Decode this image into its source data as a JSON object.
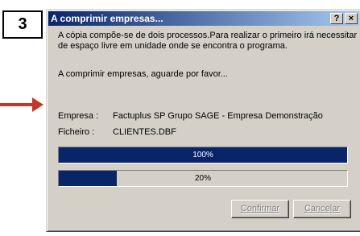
{
  "step": {
    "number": "3"
  },
  "window": {
    "title": "A comprimir empresas...",
    "help_label": "?",
    "close_label": "×"
  },
  "body": {
    "description": "A cópia compõe-se de dois processos.Para realizar o primeiro irá necessitar de espaço livre em unidade onde se encontra o programa.",
    "status": "A comprimir empresas, aguarde por favor...",
    "empresa_label": "Empresa :",
    "empresa_value": "Factuplus SP Grupo SAGE - Empresa Demonstração",
    "ficheiro_label": "Ficheiro :",
    "ficheiro_value": "CLIENTES.DBF"
  },
  "progress": [
    {
      "label": "100%",
      "value": 1.0
    },
    {
      "label": "20%",
      "value": 0.2
    }
  ],
  "buttons": {
    "confirm_label": "Confirmar",
    "cancel_label": "Cancelar"
  },
  "colors": {
    "title_start": "#0a246a",
    "title_end": "#a6caf0",
    "progress_fill": "#0a246a",
    "dialog_bg": "#d4d0c8"
  },
  "icons": {
    "annotation_arrow": "arrow-right-icon"
  }
}
